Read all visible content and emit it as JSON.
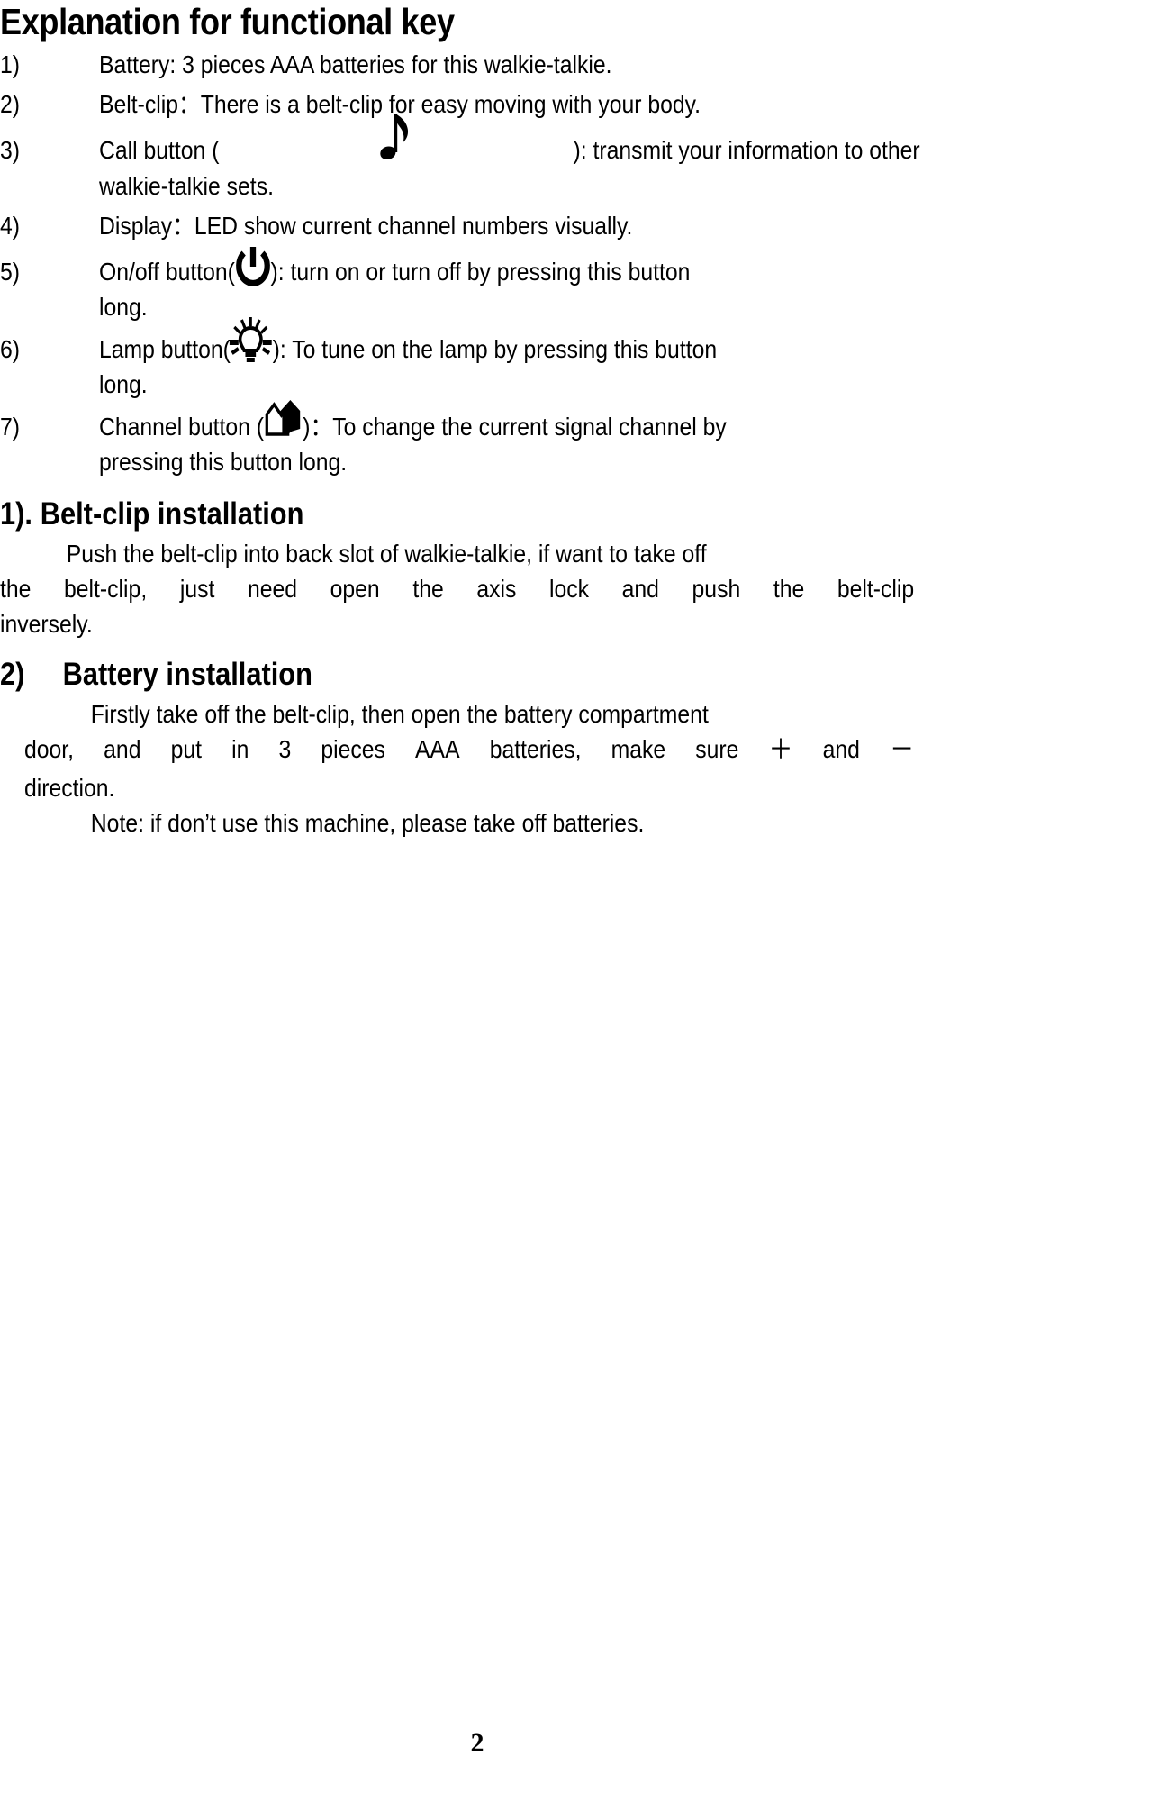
{
  "document": {
    "title": "Explanation for functional key",
    "page_number": "2"
  },
  "functional_key_list": [
    {
      "number": "1)",
      "text_before_icon": "Battery: 3 pieces AAA batteries for this walkie-talkie.",
      "icon": null,
      "text_after_icon": ""
    },
    {
      "number": "2)",
      "text_before_icon": "Belt-clip：There is a belt-clip for easy moving with your body.",
      "icon": null,
      "text_after_icon": ""
    },
    {
      "number": "3)",
      "text_before_icon": "Call button (",
      "icon": "music-note-icon",
      "text_after_icon": "): transmit your information to other walkie-talkie sets."
    },
    {
      "number": "4)",
      "text_before_icon": "Display：LED show current channel numbers visually.",
      "icon": null,
      "text_after_icon": ""
    },
    {
      "number": "5)",
      "text_before_icon": "On/off button(",
      "icon": "power-icon",
      "text_after_icon": "): turn on or turn off by pressing this button long."
    },
    {
      "number": "6)",
      "text_before_icon": "Lamp button(",
      "icon": "lamp-bulb-icon",
      "text_after_icon": "): To tune on the lamp by pressing this button long."
    },
    {
      "number": "7)",
      "text_before_icon": "Channel button (",
      "icon": "channel-arrow-icon",
      "text_after_icon": ")：To change the current signal channel by pressing this button long."
    }
  ],
  "sections": [
    {
      "heading_number": "1).",
      "heading_title": "Belt-clip installation",
      "paragraphs": [
        "Push the belt-clip into back slot of walkie-talkie, if want to take off the belt-clip, just need open the axis lock and push the belt-clip inversely."
      ]
    },
    {
      "heading_number": "2)",
      "heading_title": "Battery installation",
      "paragraphs": [
        "Firstly take off the belt-clip, then open the battery compartment door, and put in 3 pieces AAA batteries, make sure ＋ and － direction.",
        "Note: if don’t use this machine, please take off batteries."
      ],
      "battery_plus_symbol": "＋",
      "battery_minus_symbol": "－",
      "battery_line_part1": "Firstly take off the belt-clip, then open the battery compartment",
      "battery_line_part2": "door, and put in 3 pieces AAA batteries, make sure",
      "battery_line_part3": "and",
      "battery_line_part4": "direction.",
      "note_line": "Note: if don’t use this machine, please take off batteries."
    }
  ],
  "belt_clip_paragraph": {
    "line1": "Push the belt-clip into back slot of walkie-talkie, if want to take off",
    "line2": "the belt-clip, just need open the axis lock and push the belt-clip",
    "line3": "inversely."
  },
  "item_lines": {
    "item3_line1": "Call button (",
    "item3_line1b": "): transmit your information to other",
    "item3_line2": "walkie-talkie sets.",
    "item5_line1a": "On/off button(",
    "item5_line1b": "): turn on or turn off by pressing this button",
    "item5_line2": "long.",
    "item6_line1a": "Lamp button(",
    "item6_line1b": "): To tune on the lamp by pressing this button",
    "item6_line2": "long.",
    "item7_line1a": "Channel button (",
    "item7_line1b": ")：To change the current signal channel by",
    "item7_line2": "pressing this button long."
  },
  "colors": {
    "text": "#000000",
    "background": "#ffffff"
  }
}
